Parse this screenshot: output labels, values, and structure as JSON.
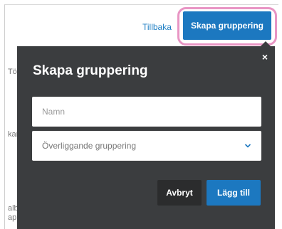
{
  "page": {
    "back_link": "Tillbaka",
    "create_button": "Skapa gruppering",
    "left_fragments": [
      "Tör",
      "kar",
      "alb",
      "ap"
    ]
  },
  "modal": {
    "title": "Skapa gruppering",
    "close_symbol": "×",
    "name_field": {
      "placeholder": "Namn",
      "value": ""
    },
    "parent_select": {
      "selected": "Överliggande gruppering",
      "icon": "chevron-down-icon"
    },
    "cancel_label": "Avbryt",
    "add_label": "Lägg till"
  },
  "colors": {
    "primary": "#1c78c0",
    "modal_background": "#3b3d3f",
    "highlight": "#e895c4",
    "link": "#1f7fc4"
  }
}
